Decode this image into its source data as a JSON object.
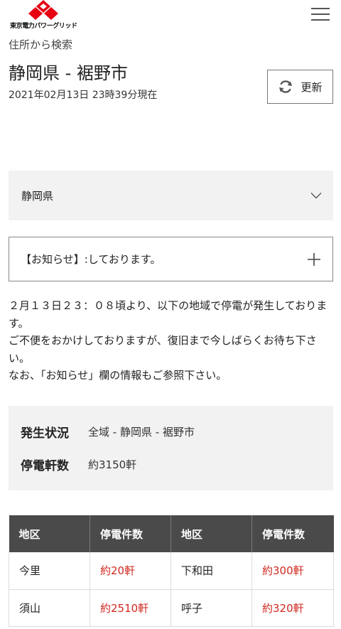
{
  "header": {
    "logo_text": "東京電力パワーグリッド",
    "logo_icon": "tepco-diamond-logo",
    "menu_icon": "hamburger-menu-icon"
  },
  "breadcrumb": "住所から検索",
  "page_title": "静岡県 - 裾野市",
  "timestamp": "2021年02月13日 23時39分現在",
  "refresh": {
    "label": "更新",
    "icon": "refresh-icon"
  },
  "prefecture_select": {
    "value": "静岡県",
    "icon": "chevron-down-icon"
  },
  "notice": {
    "text": "【お知らせ】:しております。",
    "icon": "plus-icon"
  },
  "message": {
    "lines": [
      "２月１３日２３：０８頃より、以下の地域で停電が発生しております。",
      "ご不便をおかけしておりますが、復旧まで今しばらくお待ち下さい。",
      "なお、「お知らせ」欄の情報もご参照下さい。"
    ]
  },
  "status": {
    "occurrence_label": "発生状況",
    "occurrence_value": "全域 - 静岡県 - 裾野市",
    "count_label": "停電軒数",
    "count_value": "約3150軒"
  },
  "table": {
    "headers": [
      "地区",
      "停電件数",
      "地区",
      "停電件数"
    ],
    "rows": [
      [
        "今里",
        "約20軒",
        "下和田",
        "約300軒"
      ],
      [
        "須山",
        "約2510軒",
        "呼子",
        "約320軒"
      ]
    ]
  },
  "colors": {
    "accent_red": "#d0281f",
    "table_header_bg": "#4a4a4a",
    "panel_bg": "#f2f2f2"
  }
}
